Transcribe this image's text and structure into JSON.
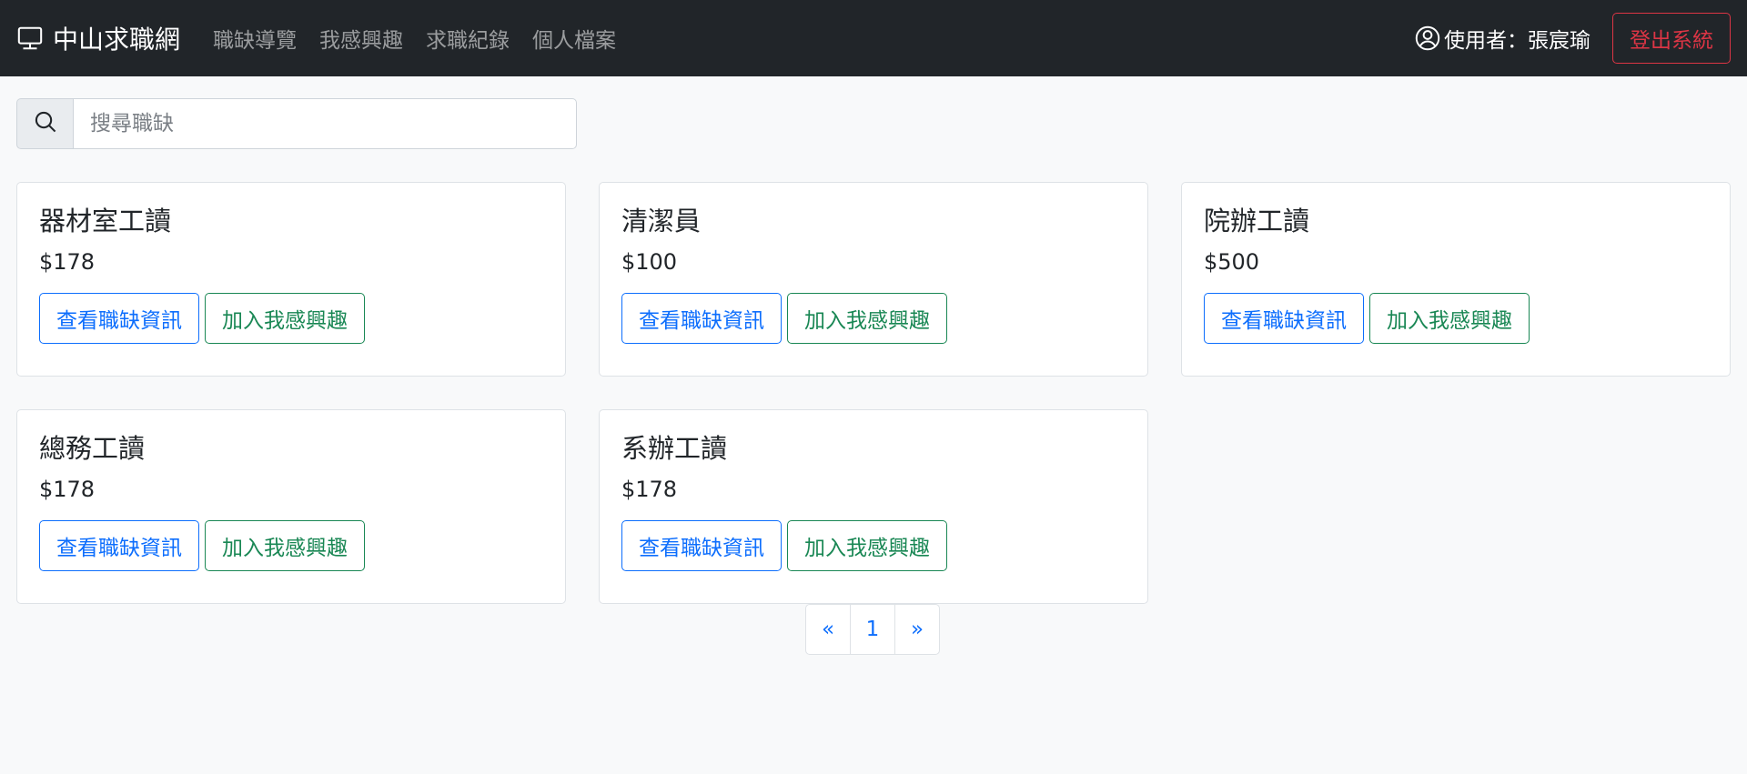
{
  "navbar": {
    "brand": "中山求職網",
    "links": [
      "職缺導覽",
      "我感興趣",
      "求職紀錄",
      "個人檔案"
    ],
    "user_label": "使用者：張宸瑜",
    "logout_label": "登出系統"
  },
  "search": {
    "placeholder": "搜尋職缺",
    "value": ""
  },
  "jobs": [
    {
      "title": "器材室工讀",
      "pay": "$178",
      "view_label": "查看職缺資訊",
      "fav_label": "加入我感興趣"
    },
    {
      "title": "清潔員",
      "pay": "$100",
      "view_label": "查看職缺資訊",
      "fav_label": "加入我感興趣"
    },
    {
      "title": "院辦工讀",
      "pay": "$500",
      "view_label": "查看職缺資訊",
      "fav_label": "加入我感興趣"
    },
    {
      "title": "總務工讀",
      "pay": "$178",
      "view_label": "查看職缺資訊",
      "fav_label": "加入我感興趣"
    },
    {
      "title": "系辦工讀",
      "pay": "$178",
      "view_label": "查看職缺資訊",
      "fav_label": "加入我感興趣"
    }
  ],
  "pagination": {
    "prev": "«",
    "current": "1",
    "next": "»"
  },
  "colors": {
    "navbar_bg": "#212529",
    "primary": "#0d6efd",
    "success": "#198754",
    "danger": "#dc3545"
  },
  "icons": {
    "brand": "display-icon",
    "user": "person-circle-icon",
    "search": "search-icon"
  }
}
